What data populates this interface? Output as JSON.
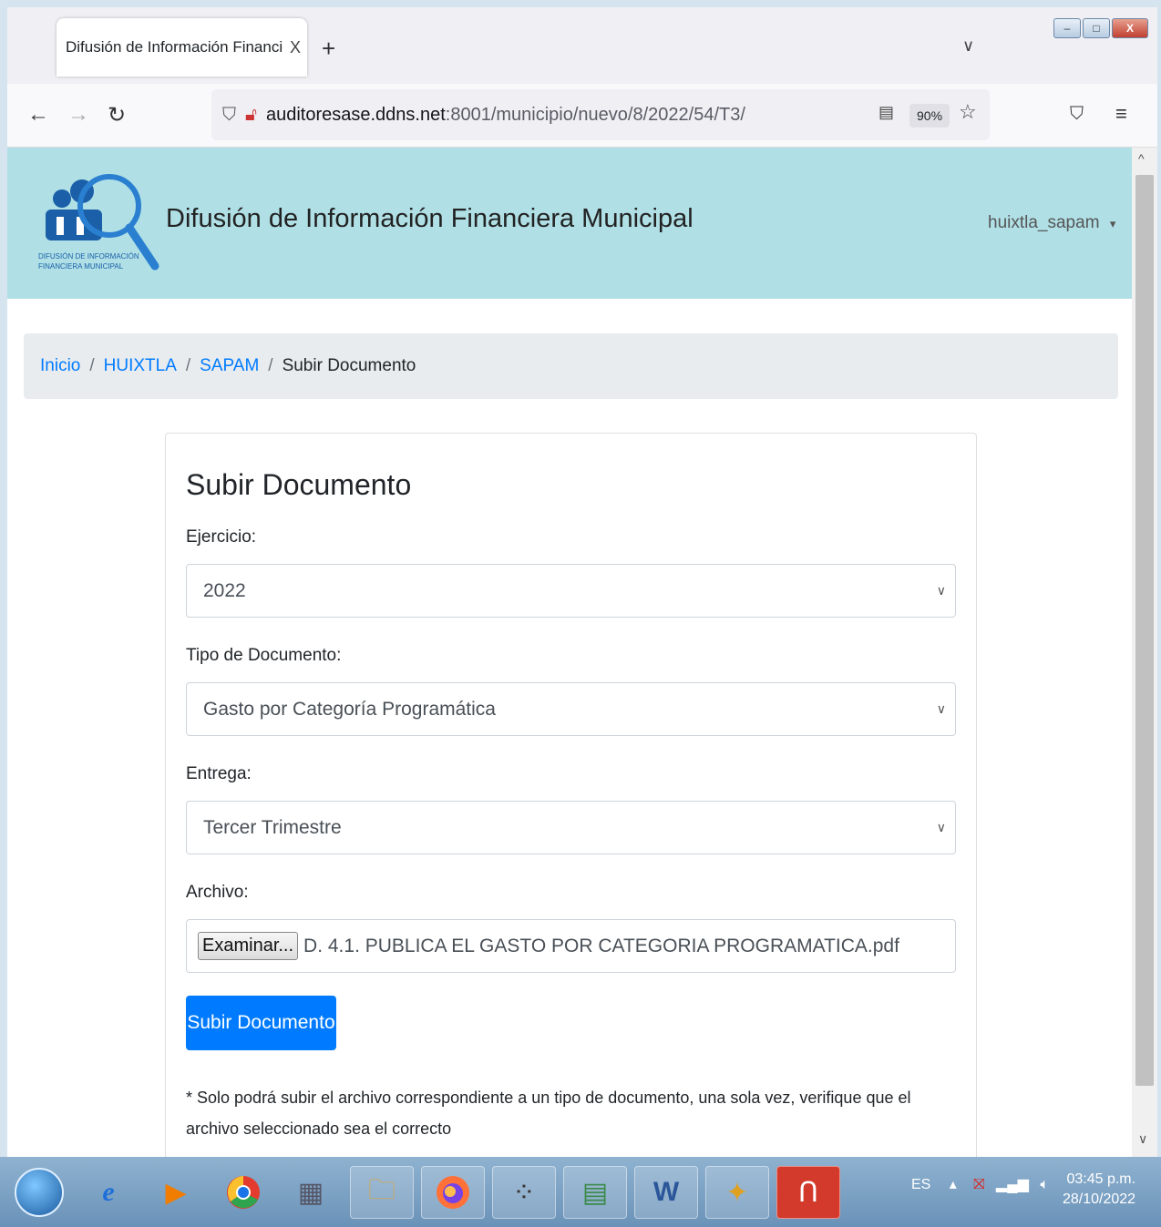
{
  "browser": {
    "tab_title": "Difusión de Información Financiera M",
    "tab_close": "X",
    "new_tab": "+",
    "tab_menu": "∨",
    "url_host": "auditoresase.ddns.net",
    "url_path": ":8001/municipio/nuevo/8/2022/54/T3/",
    "zoom": "90%",
    "window_buttons": [
      "–",
      "□",
      "X"
    ]
  },
  "site": {
    "logo_line1": "DIFUSIÓN DE INFORMACIÓN",
    "logo_line2": "FINANCIERA MUNICIPAL",
    "title": "Difusión de Información Financiera Municipal",
    "user": "huixtla_sapam",
    "user_caret": "▾"
  },
  "breadcrumb": {
    "items": [
      "Inicio",
      "HUIXTLA",
      "SAPAM"
    ],
    "active": "Subir Documento",
    "separator": "/"
  },
  "form": {
    "title": "Subir Documento",
    "ejercicio_label": "Ejercicio:",
    "ejercicio_value": "2022",
    "tipo_label": "Tipo de Documento:",
    "tipo_value": "Gasto por Categoría Programática",
    "entrega_label": "Entrega:",
    "entrega_value": "Tercer Trimestre",
    "archivo_label": "Archivo:",
    "file_button": "Examinar...",
    "file_name": "D. 4.1. PUBLICA EL GASTO POR CATEGORIA PROGRAMATICA.pdf",
    "submit": "Subir Documento",
    "note": "* Solo podrá subir el archivo correspondiente a un tipo de documento, una sola vez, verifique que el archivo seleccionado sea el correcto"
  },
  "taskbar": {
    "language": "ES",
    "time": "03:45 p.m.",
    "date": "28/10/2022"
  },
  "colors": {
    "header_bg": "#b0e0e6",
    "primary": "#007bff",
    "breadcrumb_bg": "#e9ecef"
  }
}
